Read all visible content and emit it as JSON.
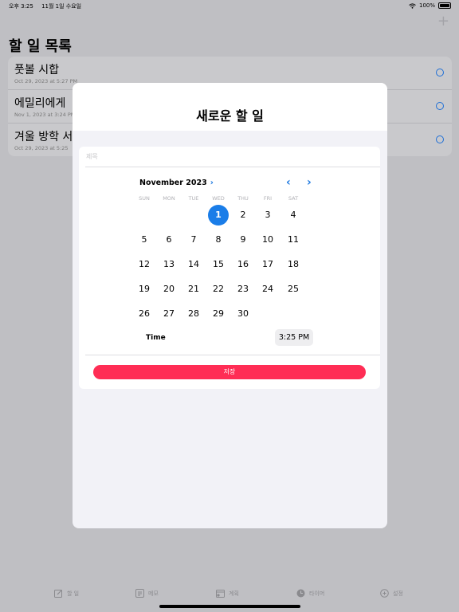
{
  "status": {
    "time": "오후 3:25",
    "date": "11월 1일 수요일",
    "battery": "100%",
    "battery_level": 1.0
  },
  "list": {
    "title": "할 일 목록",
    "add_icon": "plus-icon",
    "items": [
      {
        "title": "풋볼 시합",
        "date": "Oct 29, 2023 at 5:27 PM"
      },
      {
        "title": "에밀리에게",
        "date": "Nov 1, 2023 at 3:24 PM"
      },
      {
        "title": "겨울 방학 서",
        "date": "Oct 29, 2023 at 5:25"
      }
    ]
  },
  "modal": {
    "title": "새로운 할 일",
    "title_placeholder": "제목",
    "calendar": {
      "month": "November 2023",
      "weekdays": [
        "SUN",
        "MON",
        "TUE",
        "WED",
        "THU",
        "FRI",
        "SAT"
      ],
      "first_weekday_index": 3,
      "days": [
        "1",
        "2",
        "3",
        "4",
        "5",
        "6",
        "7",
        "8",
        "9",
        "10",
        "11",
        "12",
        "13",
        "14",
        "15",
        "16",
        "17",
        "18",
        "19",
        "20",
        "21",
        "22",
        "23",
        "24",
        "25",
        "26",
        "27",
        "28",
        "29",
        "30"
      ],
      "selected": "1"
    },
    "time_label": "Time",
    "time_value": "3:25 PM",
    "save_label": "저장",
    "accent": "#1a7de8",
    "save_color": "#ff2d55"
  },
  "tabs": [
    {
      "label": "할 일",
      "icon": "edit-icon"
    },
    {
      "label": "메모",
      "icon": "note-icon"
    },
    {
      "label": "계획",
      "icon": "calendar-icon"
    },
    {
      "label": "타이머",
      "icon": "timer-icon"
    },
    {
      "label": "설정",
      "icon": "settings-icon"
    }
  ]
}
